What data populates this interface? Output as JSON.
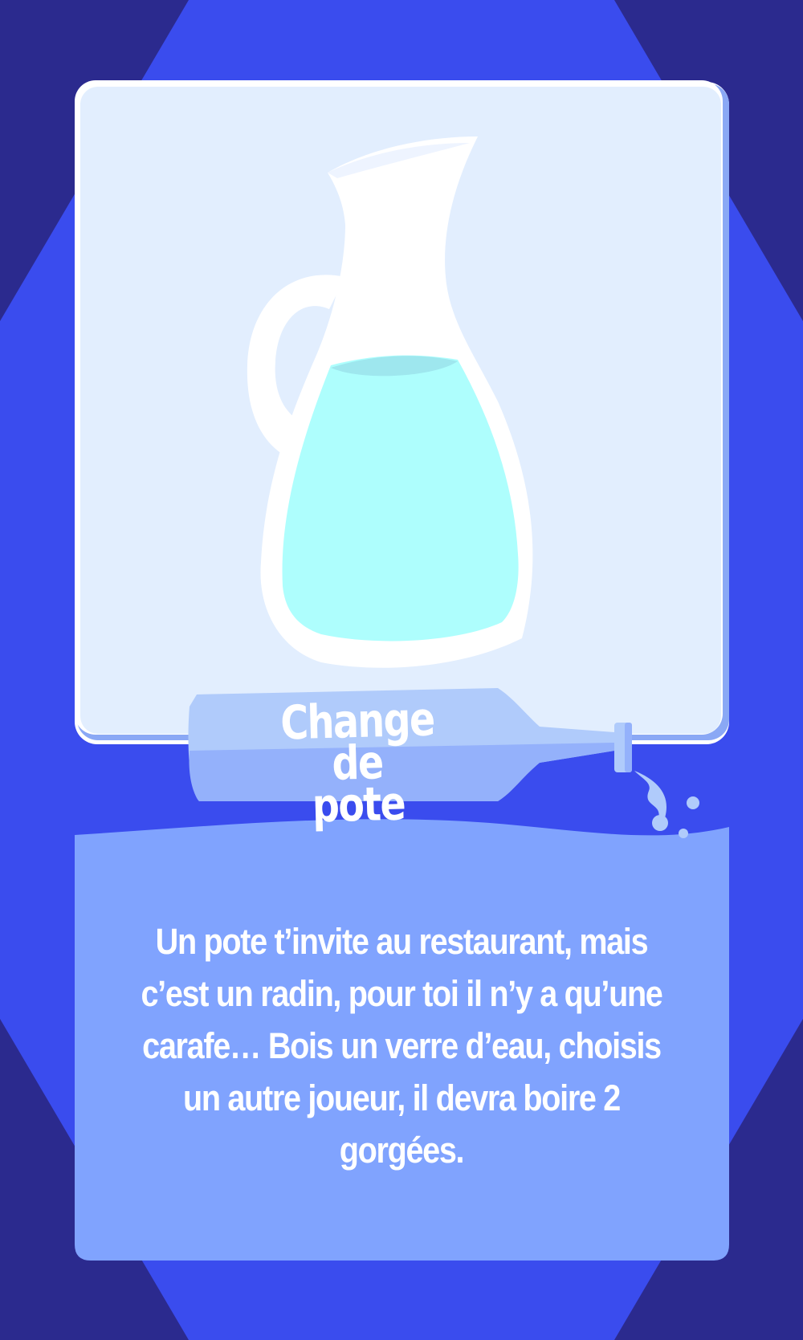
{
  "card": {
    "title_line1": "Change",
    "title_line2": "de pote",
    "body": "Un pote t’invite au restaurant, mais c’est un radin, pour toi il n’y a qu’une carafe… Bois un verre d’eau, choisis un autre joueur, il devra boire 2 gorgées."
  },
  "colors": {
    "background": "#2b2a8e",
    "octagon": "#3a4cee",
    "panel": "#e2eefe",
    "water": "#aefefd",
    "bottle": "#b0cbfb",
    "text_area": "#80a3fe"
  },
  "icons": [
    "carafe-icon",
    "bottle-icon",
    "water-splash-icon"
  ]
}
